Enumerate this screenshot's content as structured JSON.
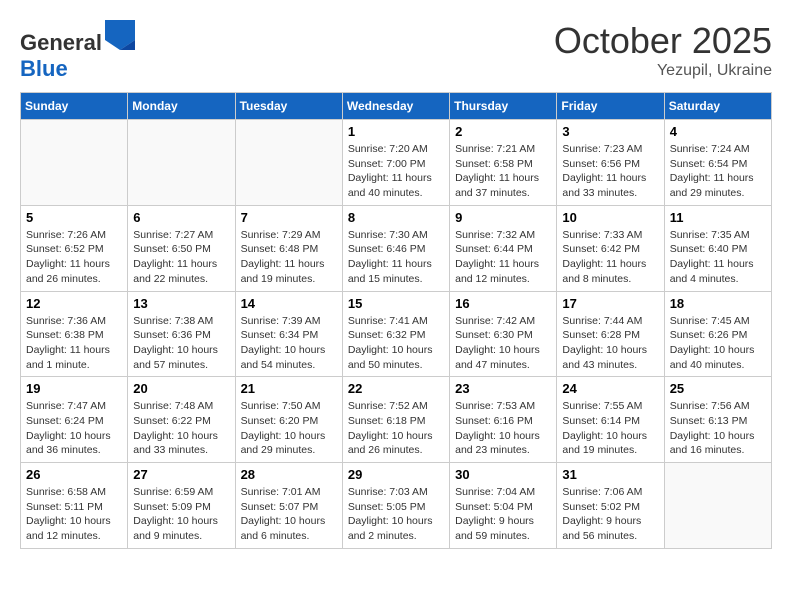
{
  "header": {
    "logo_general": "General",
    "logo_blue": "Blue",
    "month": "October 2025",
    "location": "Yezupil, Ukraine"
  },
  "weekdays": [
    "Sunday",
    "Monday",
    "Tuesday",
    "Wednesday",
    "Thursday",
    "Friday",
    "Saturday"
  ],
  "weeks": [
    [
      {
        "day": "",
        "detail": ""
      },
      {
        "day": "",
        "detail": ""
      },
      {
        "day": "",
        "detail": ""
      },
      {
        "day": "1",
        "detail": "Sunrise: 7:20 AM\nSunset: 7:00 PM\nDaylight: 11 hours\nand 40 minutes."
      },
      {
        "day": "2",
        "detail": "Sunrise: 7:21 AM\nSunset: 6:58 PM\nDaylight: 11 hours\nand 37 minutes."
      },
      {
        "day": "3",
        "detail": "Sunrise: 7:23 AM\nSunset: 6:56 PM\nDaylight: 11 hours\nand 33 minutes."
      },
      {
        "day": "4",
        "detail": "Sunrise: 7:24 AM\nSunset: 6:54 PM\nDaylight: 11 hours\nand 29 minutes."
      }
    ],
    [
      {
        "day": "5",
        "detail": "Sunrise: 7:26 AM\nSunset: 6:52 PM\nDaylight: 11 hours\nand 26 minutes."
      },
      {
        "day": "6",
        "detail": "Sunrise: 7:27 AM\nSunset: 6:50 PM\nDaylight: 11 hours\nand 22 minutes."
      },
      {
        "day": "7",
        "detail": "Sunrise: 7:29 AM\nSunset: 6:48 PM\nDaylight: 11 hours\nand 19 minutes."
      },
      {
        "day": "8",
        "detail": "Sunrise: 7:30 AM\nSunset: 6:46 PM\nDaylight: 11 hours\nand 15 minutes."
      },
      {
        "day": "9",
        "detail": "Sunrise: 7:32 AM\nSunset: 6:44 PM\nDaylight: 11 hours\nand 12 minutes."
      },
      {
        "day": "10",
        "detail": "Sunrise: 7:33 AM\nSunset: 6:42 PM\nDaylight: 11 hours\nand 8 minutes."
      },
      {
        "day": "11",
        "detail": "Sunrise: 7:35 AM\nSunset: 6:40 PM\nDaylight: 11 hours\nand 4 minutes."
      }
    ],
    [
      {
        "day": "12",
        "detail": "Sunrise: 7:36 AM\nSunset: 6:38 PM\nDaylight: 11 hours\nand 1 minute."
      },
      {
        "day": "13",
        "detail": "Sunrise: 7:38 AM\nSunset: 6:36 PM\nDaylight: 10 hours\nand 57 minutes."
      },
      {
        "day": "14",
        "detail": "Sunrise: 7:39 AM\nSunset: 6:34 PM\nDaylight: 10 hours\nand 54 minutes."
      },
      {
        "day": "15",
        "detail": "Sunrise: 7:41 AM\nSunset: 6:32 PM\nDaylight: 10 hours\nand 50 minutes."
      },
      {
        "day": "16",
        "detail": "Sunrise: 7:42 AM\nSunset: 6:30 PM\nDaylight: 10 hours\nand 47 minutes."
      },
      {
        "day": "17",
        "detail": "Sunrise: 7:44 AM\nSunset: 6:28 PM\nDaylight: 10 hours\nand 43 minutes."
      },
      {
        "day": "18",
        "detail": "Sunrise: 7:45 AM\nSunset: 6:26 PM\nDaylight: 10 hours\nand 40 minutes."
      }
    ],
    [
      {
        "day": "19",
        "detail": "Sunrise: 7:47 AM\nSunset: 6:24 PM\nDaylight: 10 hours\nand 36 minutes."
      },
      {
        "day": "20",
        "detail": "Sunrise: 7:48 AM\nSunset: 6:22 PM\nDaylight: 10 hours\nand 33 minutes."
      },
      {
        "day": "21",
        "detail": "Sunrise: 7:50 AM\nSunset: 6:20 PM\nDaylight: 10 hours\nand 29 minutes."
      },
      {
        "day": "22",
        "detail": "Sunrise: 7:52 AM\nSunset: 6:18 PM\nDaylight: 10 hours\nand 26 minutes."
      },
      {
        "day": "23",
        "detail": "Sunrise: 7:53 AM\nSunset: 6:16 PM\nDaylight: 10 hours\nand 23 minutes."
      },
      {
        "day": "24",
        "detail": "Sunrise: 7:55 AM\nSunset: 6:14 PM\nDaylight: 10 hours\nand 19 minutes."
      },
      {
        "day": "25",
        "detail": "Sunrise: 7:56 AM\nSunset: 6:13 PM\nDaylight: 10 hours\nand 16 minutes."
      }
    ],
    [
      {
        "day": "26",
        "detail": "Sunrise: 6:58 AM\nSunset: 5:11 PM\nDaylight: 10 hours\nand 12 minutes."
      },
      {
        "day": "27",
        "detail": "Sunrise: 6:59 AM\nSunset: 5:09 PM\nDaylight: 10 hours\nand 9 minutes."
      },
      {
        "day": "28",
        "detail": "Sunrise: 7:01 AM\nSunset: 5:07 PM\nDaylight: 10 hours\nand 6 minutes."
      },
      {
        "day": "29",
        "detail": "Sunrise: 7:03 AM\nSunset: 5:05 PM\nDaylight: 10 hours\nand 2 minutes."
      },
      {
        "day": "30",
        "detail": "Sunrise: 7:04 AM\nSunset: 5:04 PM\nDaylight: 9 hours\nand 59 minutes."
      },
      {
        "day": "31",
        "detail": "Sunrise: 7:06 AM\nSunset: 5:02 PM\nDaylight: 9 hours\nand 56 minutes."
      },
      {
        "day": "",
        "detail": ""
      }
    ]
  ]
}
